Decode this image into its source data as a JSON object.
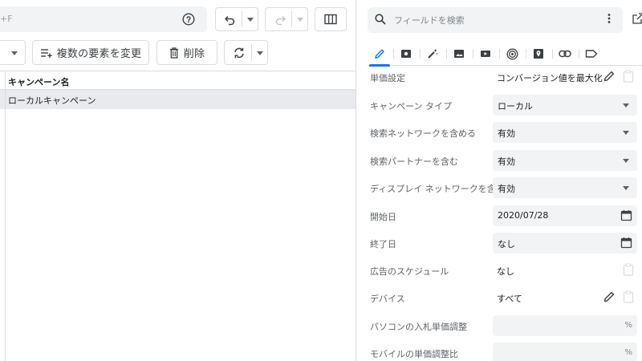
{
  "toolbar": {
    "search_shortcut": "+F",
    "change_multiple_label": "複数の要素を変更",
    "delete_label": "削除"
  },
  "grid": {
    "column_header": "キャンペーン名",
    "rows": [
      {
        "campaign_name": "ローカルキャンペーン"
      }
    ]
  },
  "editor": {
    "search": {
      "placeholder": "フィールドを検索"
    },
    "tabs": [
      "edit",
      "id-card",
      "magic-wand",
      "image-ad",
      "video",
      "target",
      "location-pin",
      "link",
      "label"
    ],
    "properties": [
      {
        "label": "単価設定",
        "value": "コンバージョン値を最大化",
        "kind": "text-edit"
      },
      {
        "label": "キャンペーン タイプ",
        "value": "ローカル",
        "kind": "select"
      },
      {
        "label": "検索ネットワークを含める",
        "value": "有効",
        "kind": "select"
      },
      {
        "label": "検索パートナーを含む",
        "value": "有効",
        "kind": "select"
      },
      {
        "label": "ディスプレイ ネットワークを含める",
        "value": "有効",
        "kind": "select"
      },
      {
        "label": "開始日",
        "value": "2020/07/28",
        "kind": "date"
      },
      {
        "label": "終了日",
        "value": "なし",
        "kind": "date"
      },
      {
        "label": "広告のスケジュール",
        "value": "なし",
        "kind": "text-clip"
      },
      {
        "label": "デバイス",
        "value": "すべて",
        "kind": "text-edit"
      },
      {
        "label": "パソコンの入札単価調整",
        "value": "",
        "unit": "%",
        "kind": "percent"
      },
      {
        "label": "モバイルの単価調整比",
        "value": "",
        "unit": "%",
        "kind": "percent"
      }
    ]
  },
  "colors": {
    "accent": "#1a73e8",
    "panel_bg": "#f1f3f4",
    "selected_row": "#e8eaed",
    "border": "#dadce0"
  }
}
